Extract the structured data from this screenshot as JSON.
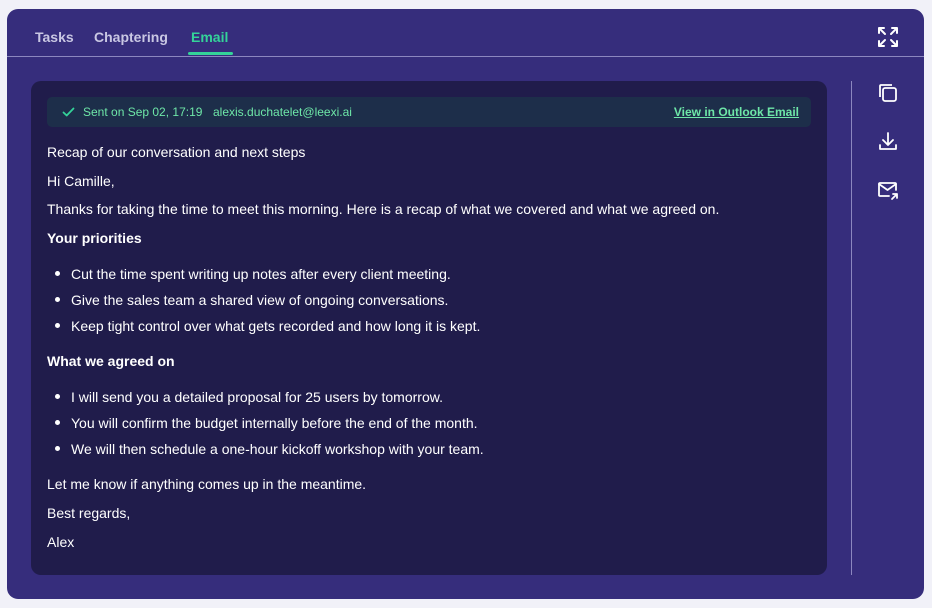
{
  "tabs": [
    {
      "label": "Tasks",
      "active": false
    },
    {
      "label": "Chaptering",
      "active": false
    },
    {
      "label": "Email",
      "active": true
    }
  ],
  "icons": {
    "expand": "expand-icon",
    "copy": "copy-icon",
    "download": "download-icon",
    "send_email": "mail-forward-icon",
    "status": "check-icon"
  },
  "colors": {
    "panel_bg": "#362d7c",
    "card_bg": "#201c4b",
    "accent": "#34d399",
    "status_text": "#6ee7a8"
  },
  "email": {
    "status": {
      "sent_label": "Sent on Sep 02, 17:19",
      "sender": "alexis.duchatelet@leexi.ai",
      "link_label": "View in Outlook Email"
    },
    "subject": "Recap of our conversation and next steps",
    "greeting": "Hi Camille,",
    "intro": "Thanks for taking the time to meet this morning. Here is a recap of what we covered and what we agreed on.",
    "section1": {
      "heading": "Your priorities",
      "items": [
        "Cut the time spent writing up notes after every client meeting.",
        "Give the sales team a shared view of ongoing conversations.",
        "Keep tight control over what gets recorded and how long it is kept."
      ]
    },
    "section2": {
      "heading": "What we agreed on",
      "items": [
        "I will send you a detailed proposal for 25 users by tomorrow.",
        "You will confirm the budget internally before the end of the month.",
        "We will then schedule a one-hour kickoff workshop with your team."
      ]
    },
    "closing": "Let me know if anything comes up in the meantime.",
    "signoff": "Best regards,",
    "signature": "Alex"
  }
}
